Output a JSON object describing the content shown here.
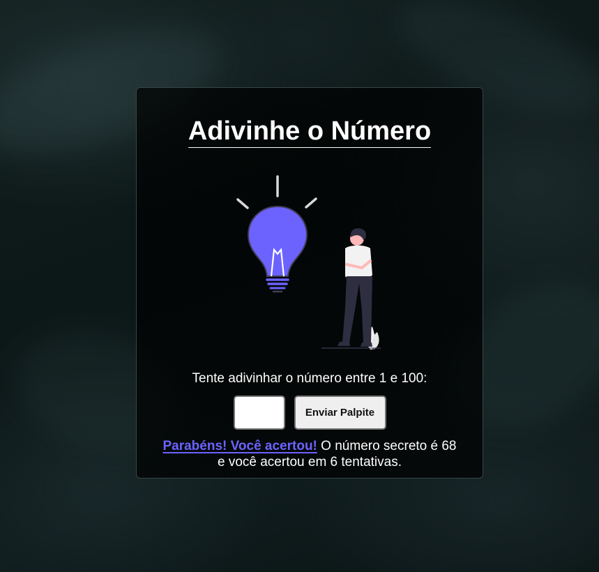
{
  "page": {
    "title": "Adivinhe o Número"
  },
  "game": {
    "instruction": "Tente adivinhar o número entre 1 e 100:",
    "guess_value": "",
    "submit_label": "Enviar Palpite",
    "result_highlight": "Parabéns! Você acertou!",
    "result_text": " O número secreto é 68 e você acertou em 6 tentativas."
  },
  "illustration": {
    "icons": [
      "lightbulb-icon",
      "person-figure",
      "plant-icon"
    ],
    "bulb_color": "#6c63ff"
  },
  "colors": {
    "accent": "#6c63ff",
    "text": "#ffffff",
    "card_background": "#000000"
  }
}
